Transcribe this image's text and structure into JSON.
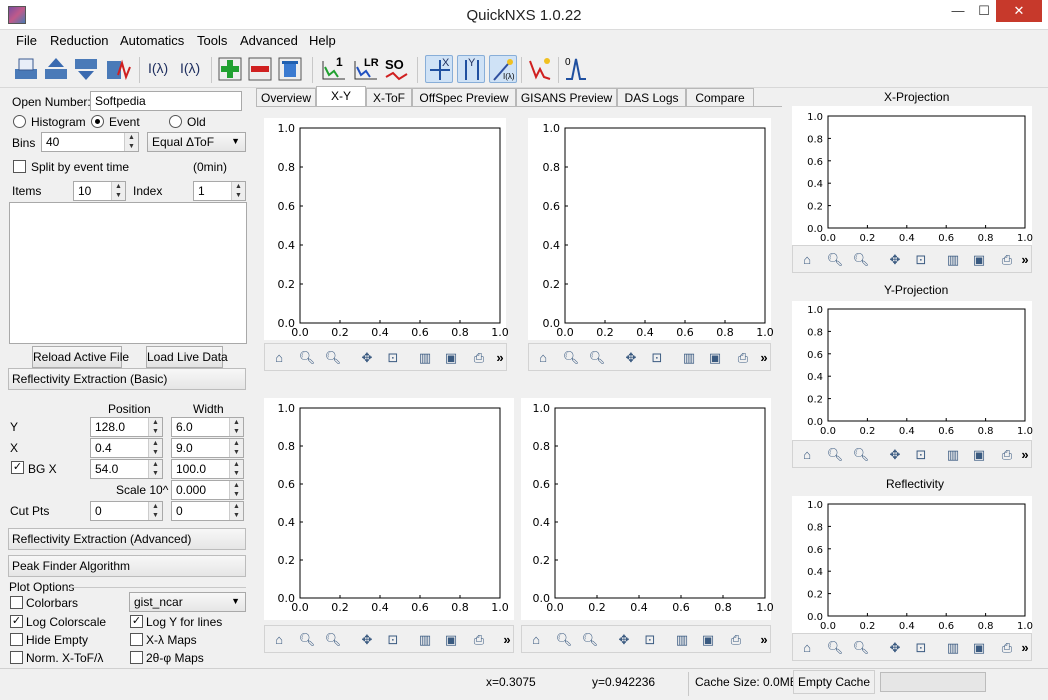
{
  "window": {
    "title": "QuickNXS   1.0.22",
    "minimize": "—",
    "maximize": "☐",
    "close": "✕"
  },
  "menu": [
    "File",
    "Reduction",
    "Automatics",
    "Tools",
    "Advanced",
    "Help"
  ],
  "toolbar": {
    "labels": {
      "i_lambda": "I(λ)",
      "i_lambda2": "I(λ)",
      "one": "1",
      "lr": "LR",
      "so": "SO",
      "x": "X",
      "y": "Y",
      "i_lam3": "I(λ)",
      "zero": "0"
    }
  },
  "left": {
    "open_number_label": "Open Number:",
    "open_number_value": "Softpedia",
    "mode": {
      "histogram": "Histogram",
      "event": "Event",
      "old": "Old"
    },
    "bins_label": "Bins",
    "bins_value": "40",
    "bins_type": "Equal ΔToF",
    "split_label": "Split by event time",
    "split_time": "(0min)",
    "items_label": "Items",
    "items_value": "10",
    "index_label": "Index",
    "index_value": "1",
    "reload_button": "Reload Active File",
    "load_live_button": "Load Live Data",
    "basic_section": "Reflectivity Extraction (Basic)",
    "position_header": "Position",
    "width_header": "Width",
    "y_label": "Y",
    "y_position": "128.0",
    "y_width": "6.0",
    "x_label": "X",
    "x_position": "0.4",
    "x_width": "9.0",
    "bgx_label": "BG X",
    "bgx_position": "54.0",
    "bgx_width": "100.0",
    "scale_label": "Scale 10^",
    "scale_value": "0.000",
    "cutpts_label": "Cut Pts",
    "cutpts_a": "0",
    "cutpts_b": "0",
    "advanced_section": "Reflectivity Extraction (Advanced)",
    "peak_section": "Peak Finder Algorithm",
    "plot_options_label": "Plot Options",
    "colorbars": "Colorbars",
    "colormap": "gist_ncar",
    "log_colorscale": "Log Colorscale",
    "log_y": "Log Y for lines",
    "hide_empty": "Hide Empty",
    "x_lambda_maps": "X-λ Maps",
    "norm_xtof": "Norm. X-ToF/λ",
    "two_theta_maps": "2θ-φ Maps"
  },
  "tabs": [
    "Overview",
    "X-Y",
    "X-ToF",
    "OffSpec Preview",
    "GISANS Preview",
    "DAS Logs",
    "Compare"
  ],
  "selected_tab": "X-Y",
  "plot_axes": {
    "yticks": [
      "1.0",
      "0.8",
      "0.6",
      "0.4",
      "0.2",
      "0.0"
    ],
    "xticks": [
      "0.0",
      "0.2",
      "0.4",
      "0.6",
      "0.8",
      "1.0"
    ]
  },
  "right_panels": {
    "x_projection": "X-Projection",
    "y_projection": "Y-Projection",
    "reflectivity": "Reflectivity"
  },
  "nav_more": "»",
  "status": {
    "x": "x=0.3075",
    "y": "y=0.942236",
    "cache_size": "Cache Size: 0.0MB",
    "empty_cache": "Empty Cache"
  }
}
